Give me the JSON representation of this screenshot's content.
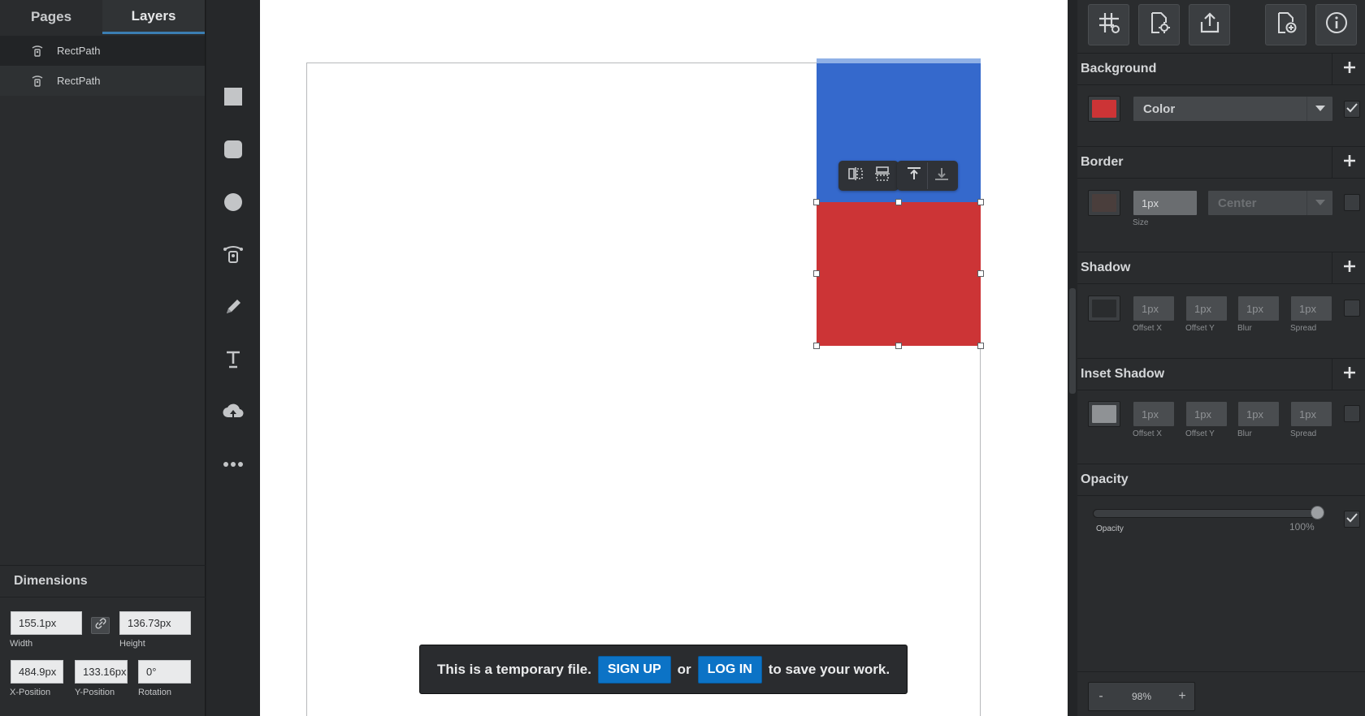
{
  "left_panel": {
    "tabs": [
      "Pages",
      "Layers"
    ],
    "active_tab": "Layers",
    "layers": [
      {
        "label": "RectPath",
        "icon": "path-icon"
      },
      {
        "label": "RectPath",
        "icon": "path-icon"
      }
    ],
    "dimensions": {
      "title": "Dimensions",
      "width": {
        "value": "155.1px",
        "label": "Width"
      },
      "height": {
        "value": "136.73px",
        "label": "Height"
      },
      "x": {
        "value": "484.9px",
        "label": "X-Position"
      },
      "y": {
        "value": "133.16px",
        "label": "Y-Position"
      },
      "rotation": {
        "value": "0°",
        "label": "Rotation"
      }
    }
  },
  "tools": [
    "rectangle-tool-icon",
    "rounded-rectangle-tool-icon",
    "ellipse-tool-icon",
    "path-tool-icon",
    "pencil-tool-icon",
    "text-tool-icon",
    "upload-icon",
    "more-icon"
  ],
  "canvas": {
    "fill_colors": {
      "blue": "#3569cc",
      "red": "#cc3436"
    },
    "toast": {
      "text_before": "This is a temporary file.",
      "signup": "SIGN UP",
      "or": "or",
      "login": "LOG IN",
      "text_after": "to save your work."
    }
  },
  "right_panel": {
    "top_buttons": [
      "grid-settings-icon",
      "document-settings-icon",
      "export-icon",
      "add-page-icon",
      "info-icon"
    ],
    "background": {
      "title": "Background",
      "color": "#cc3436",
      "type": "Color",
      "enabled": true
    },
    "border": {
      "title": "Border",
      "color": "#4a3e3c",
      "size": "1px",
      "size_label": "Size",
      "position": "Center",
      "enabled": false
    },
    "shadow": {
      "title": "Shadow",
      "color": "#2a2c2e",
      "fields": [
        {
          "value": "1px",
          "label": "Offset X"
        },
        {
          "value": "1px",
          "label": "Offset Y"
        },
        {
          "value": "1px",
          "label": "Blur"
        },
        {
          "value": "1px",
          "label": "Spread"
        }
      ],
      "enabled": false
    },
    "inset_shadow": {
      "title": "Inset Shadow",
      "color": "#8f9295",
      "fields": [
        {
          "value": "1px",
          "label": "Offset X"
        },
        {
          "value": "1px",
          "label": "Offset Y"
        },
        {
          "value": "1px",
          "label": "Blur"
        },
        {
          "value": "1px",
          "label": "Spread"
        }
      ],
      "enabled": false
    },
    "opacity": {
      "title": "Opacity",
      "label": "Opacity",
      "value": "100%",
      "level": 1.0,
      "enabled": true
    },
    "zoom": {
      "minus": "-",
      "value": "98%",
      "plus": "+"
    }
  }
}
